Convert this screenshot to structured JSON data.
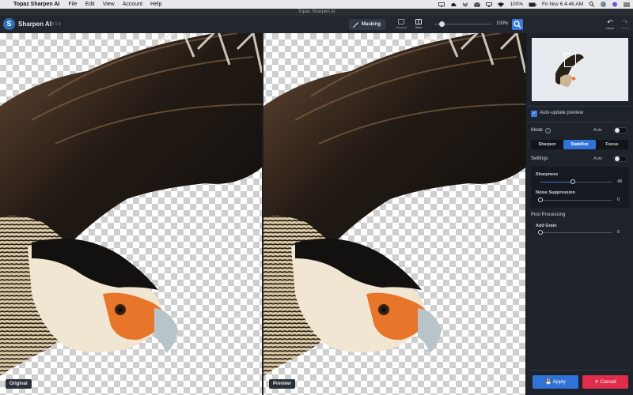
{
  "menubar": {
    "app": "Topaz Sharpen AI",
    "items": [
      "File",
      "Edit",
      "View",
      "Account",
      "Help"
    ],
    "battery": "100%",
    "clock": "Fri Nov 6  4:46 AM"
  },
  "window": {
    "title": "Topaz Sharpen AI"
  },
  "toolbar": {
    "app_name": "Sharpen AI",
    "version": "v2.1.8",
    "masking_label": "Masking",
    "original_label": "Original",
    "view_label": "View",
    "zoom": "100%",
    "undo_label": "Undo",
    "redo_label": "Redo"
  },
  "canvas": {
    "left_label": "Original",
    "right_label": "Preview"
  },
  "panel": {
    "auto_update_label": "Auto-update preview",
    "mode_label": "Mode",
    "auto_label": "Auto",
    "modes": [
      "Sharpen",
      "Stabilize",
      "Focus"
    ],
    "active_mode": "Stabilize",
    "settings_label": "Settings",
    "settings_auto_label": "Auto",
    "sharpness_label": "Sharpness",
    "sharpness_value": "48",
    "noise_label": "Noise Suppression",
    "noise_value": "0",
    "post_processing_label": "Post Processing",
    "grain_label": "Add Grain",
    "grain_value": "0",
    "apply_label": "Apply",
    "cancel_label": "Cancel"
  },
  "colors": {
    "accent": "#2f73d9",
    "cancel": "#e02d4a",
    "panel_bg": "#1e232b"
  }
}
